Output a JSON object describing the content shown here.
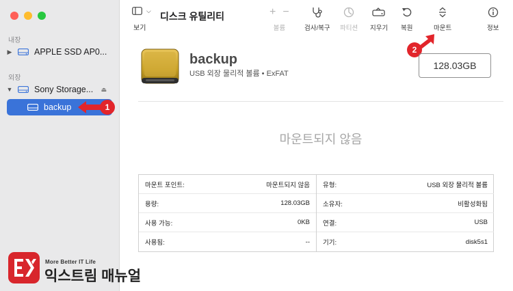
{
  "sidebar": {
    "section_internal": "내장",
    "section_external": "외장",
    "items": [
      {
        "label": "APPLE SSD AP0...",
        "expanded": false
      },
      {
        "label": "Sony Storage...",
        "expanded": true
      },
      {
        "label": "backup",
        "selected": true
      }
    ]
  },
  "toolbar": {
    "view_label": "보기",
    "title": "디스크 유틸리티",
    "volume_label": "볼륨",
    "firstaid_label": "검사/복구",
    "partition_label": "파티션",
    "erase_label": "지우기",
    "restore_label": "복원",
    "mount_label": "마운트",
    "info_label": "정보"
  },
  "volume": {
    "name": "backup",
    "subtitle": "USB 외장 물리적 볼륨 • ExFAT",
    "size": "128.03GB",
    "status": "마운트되지 않음"
  },
  "info_left": [
    {
      "key": "마운트 포인트:",
      "value": "마운트되지 않음"
    },
    {
      "key": "용량:",
      "value": "128.03GB"
    },
    {
      "key": "사용 가능:",
      "value": "0KB"
    },
    {
      "key": "사용됨:",
      "value": "--"
    }
  ],
  "info_right": [
    {
      "key": "유형:",
      "value": "USB 외장 물리적 볼륨"
    },
    {
      "key": "소유자:",
      "value": "비활성화됨"
    },
    {
      "key": "연결:",
      "value": "USB"
    },
    {
      "key": "기기:",
      "value": "disk5s1"
    }
  ],
  "annotations": {
    "step1": "1",
    "step2": "2"
  },
  "watermark": {
    "tagline": "More Better IT Life",
    "brand": "익스트림 매뉴얼"
  },
  "colors": {
    "selection": "#3a73d9",
    "annotation": "#e2252b",
    "drive": "#c9a227"
  }
}
